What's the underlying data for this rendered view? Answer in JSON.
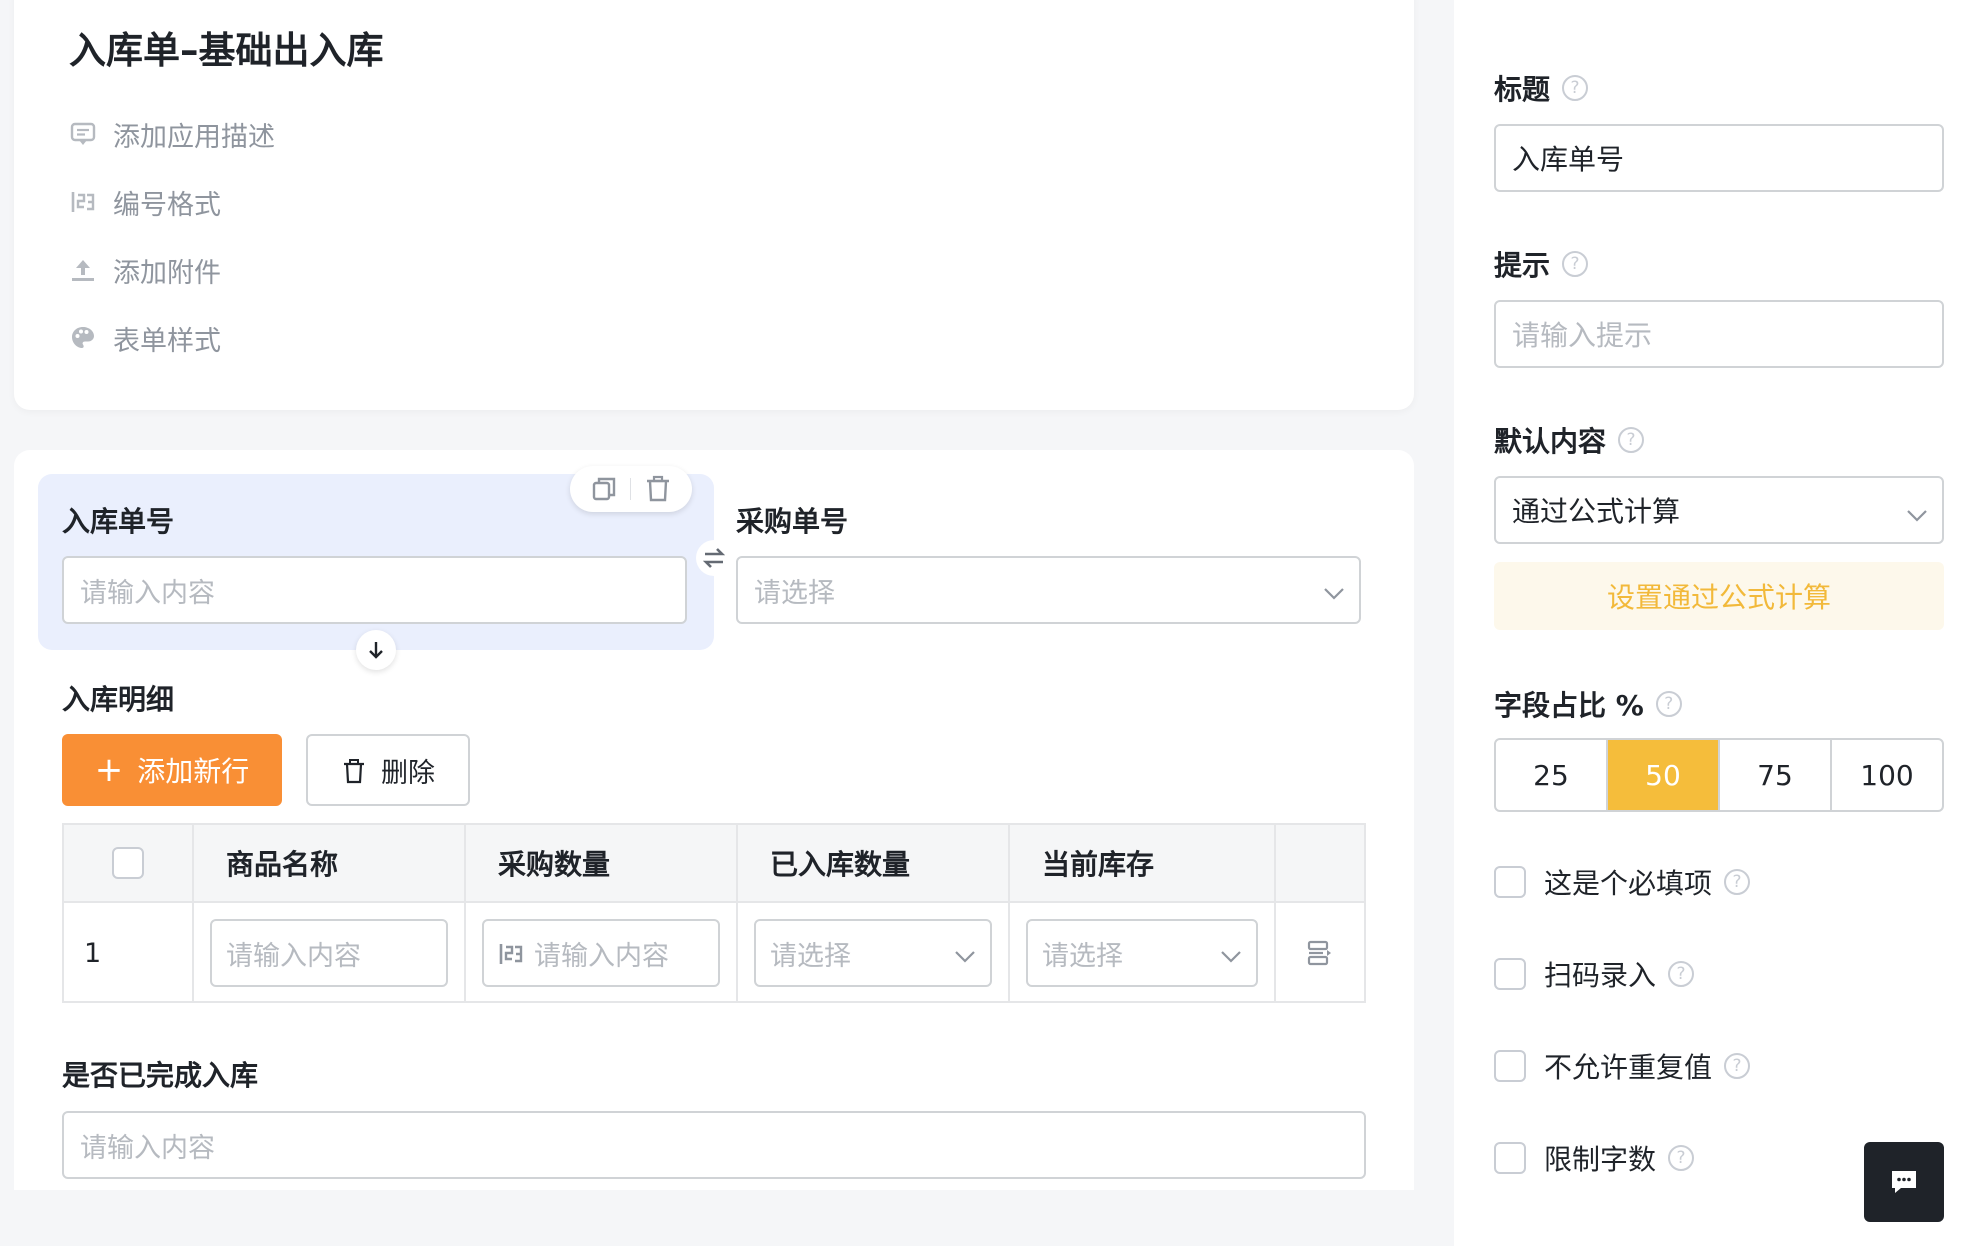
{
  "app": {
    "title": "入库单–基础出入库",
    "meta_items": [
      {
        "icon": "comment-icon",
        "label": "添加应用描述"
      },
      {
        "icon": "serial-number-icon",
        "label": "编号格式"
      },
      {
        "icon": "upload-icon",
        "label": "添加附件"
      },
      {
        "icon": "palette-icon",
        "label": "表单样式"
      }
    ]
  },
  "form": {
    "field1": {
      "label": "入库单号",
      "placeholder": "请输入内容"
    },
    "field2": {
      "label": "采购单号",
      "placeholder": "请选择"
    },
    "subtable": {
      "label": "入库明细",
      "add_row_label": "添加新行",
      "delete_label": "删除",
      "columns": [
        "商品名称",
        "采购数量",
        "已入库数量",
        "当前库存"
      ],
      "row": {
        "index": "1",
        "product_placeholder": "请输入内容",
        "qty_placeholder": "请输入内容",
        "received_placeholder": "请选择",
        "stock_placeholder": "请选择"
      }
    },
    "field3": {
      "label": "是否已完成入库",
      "placeholder": "请输入内容"
    }
  },
  "settings": {
    "title_label": "标题",
    "title_value": "入库单号",
    "hint_label": "提示",
    "hint_placeholder": "请输入提示",
    "default_label": "默认内容",
    "default_value": "通过公式计算",
    "formula_button": "设置通过公式计算",
    "width_label": "字段占比 %",
    "width_options": [
      "25",
      "50",
      "75",
      "100"
    ],
    "width_selected": "50",
    "checks": [
      {
        "label": "这是个必填项"
      },
      {
        "label": "扫码录入"
      },
      {
        "label": "不允许重复值"
      },
      {
        "label": "限制字数"
      }
    ]
  },
  "colors": {
    "accent_orange": "#f98f35",
    "accent_yellow": "#f5bd3b",
    "selected_field_bg": "#eaeffd"
  }
}
